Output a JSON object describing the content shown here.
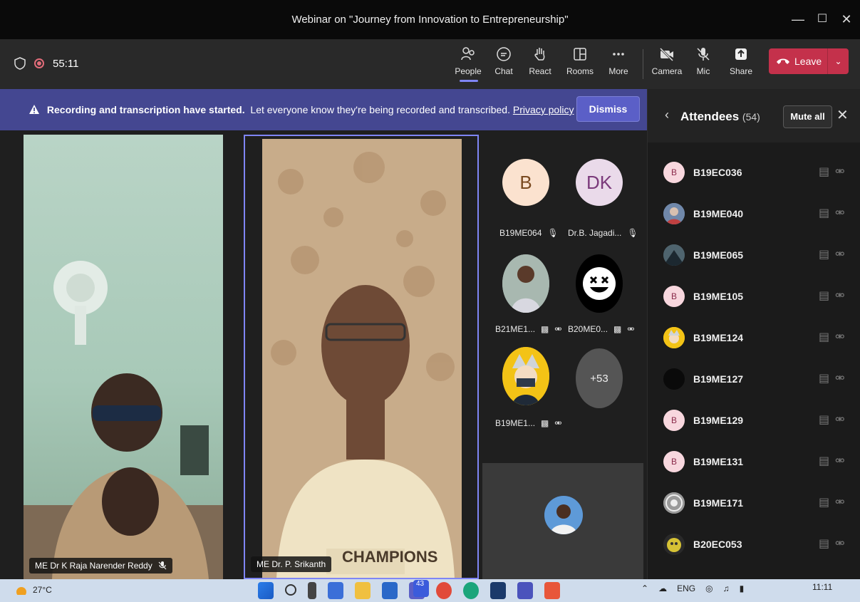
{
  "window": {
    "title": "Webinar on \"Journey from Innovation to Entrepreneurship\"",
    "controls": [
      "minimize",
      "maximize",
      "close"
    ]
  },
  "toolbar": {
    "timer": "55:11",
    "buttons": [
      {
        "label": "People",
        "icon": "people-icon",
        "active": true
      },
      {
        "label": "Chat",
        "icon": "chat-icon"
      },
      {
        "label": "React",
        "icon": "react-hand-icon"
      },
      {
        "label": "Rooms",
        "icon": "rooms-icon"
      },
      {
        "label": "More",
        "icon": "more-icon"
      },
      {
        "label": "Camera",
        "icon": "camera-off-icon"
      },
      {
        "label": "Mic",
        "icon": "mic-off-icon"
      },
      {
        "label": "Share",
        "icon": "share-icon"
      }
    ],
    "leave_label": "Leave",
    "accent": "#c4314b"
  },
  "banner": {
    "bold": "Recording and transcription have started.",
    "text": "Let everyone know they're being recorded and transcribed.",
    "link": "Privacy policy",
    "dismiss": "Dismiss"
  },
  "stage": {
    "tiles": [
      {
        "name": "ME Dr K Raja Narender Reddy",
        "muted": true
      },
      {
        "name": "ME Dr. P. Srikanth",
        "active_speaker": true
      }
    ],
    "shirt_text": "CHAMPIONS",
    "grid": [
      {
        "initials": "B",
        "label": "B19ME064",
        "bg": "#fbe2cf",
        "fg": "#7a4a20"
      },
      {
        "initials": "DK",
        "label": "Dr.B. Jagadi...",
        "bg": "#eadaea",
        "fg": "#7b3a7b"
      },
      {
        "initials": "",
        "label": "B21ME1..."
      },
      {
        "initials": "",
        "label": "B20ME0..."
      },
      {
        "initials": "",
        "label": "B19ME1..."
      },
      {
        "initials": "+53",
        "label": ""
      }
    ]
  },
  "panel": {
    "title": "Attendees",
    "count": "(54)",
    "mute_all": "Mute all",
    "attendees": [
      {
        "name": "B19EC036",
        "avatar": "B"
      },
      {
        "name": "B19ME040",
        "avatar": ""
      },
      {
        "name": "B19ME065",
        "avatar": ""
      },
      {
        "name": "B19ME105",
        "avatar": "B"
      },
      {
        "name": "B19ME124",
        "avatar": ""
      },
      {
        "name": "B19ME127",
        "avatar": ""
      },
      {
        "name": "B19ME129",
        "avatar": "B"
      },
      {
        "name": "B19ME131",
        "avatar": "B"
      },
      {
        "name": "B19ME171",
        "avatar": ""
      },
      {
        "name": "B20EC053",
        "avatar": ""
      }
    ]
  },
  "taskbar": {
    "temperature": "27°C",
    "badge": "43",
    "lang": "ENG",
    "time": "11:11"
  }
}
